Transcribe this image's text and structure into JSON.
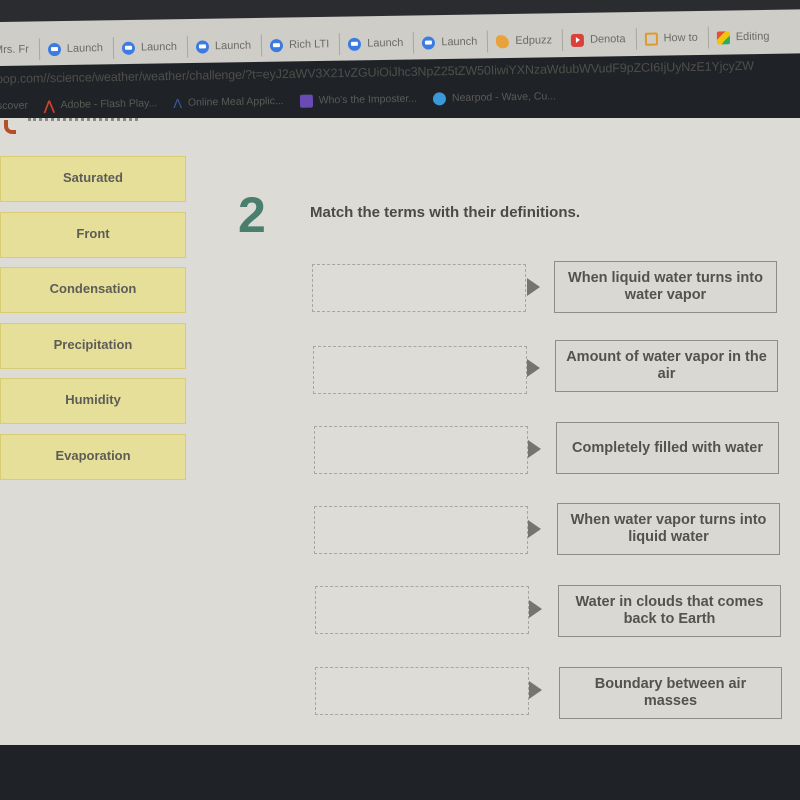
{
  "browser": {
    "tabs": [
      {
        "label": "Mrs. Fr",
        "icon": "none"
      },
      {
        "label": "Launch",
        "icon": "zoom-icon"
      },
      {
        "label": "Launch",
        "icon": "zoom-icon"
      },
      {
        "label": "Launch",
        "icon": "zoom-icon"
      },
      {
        "label": "Rich LTI",
        "icon": "zoom-icon"
      },
      {
        "label": "Launch",
        "icon": "zoom-icon"
      },
      {
        "label": "Launch",
        "icon": "zoom-icon"
      },
      {
        "label": "Edpuzz",
        "icon": "edpuzzle-icon"
      },
      {
        "label": "Denota",
        "icon": "youtube-icon"
      },
      {
        "label": "How to",
        "icon": "slides-icon"
      },
      {
        "label": "Editing",
        "icon": "editing-icon"
      }
    ],
    "url": "pop.com//science/weather/weather/challenge/?t=eyJ2aWV3X21vZGUiOiJhc3NpZ25tZW50IiwiYXNzaWdubWVudF9pZCI6IjUyNzE1YjcyZW",
    "bookmarks": [
      {
        "label": "scover",
        "icon": "none"
      },
      {
        "label": "Adobe - Flash Play...",
        "icon": "adobe-icon"
      },
      {
        "label": "Online Meal Applic...",
        "icon": "meal-app-icon"
      },
      {
        "label": "Who's the Imposter...",
        "icon": "forms-icon"
      },
      {
        "label": "Nearpod - Wave, Cu...",
        "icon": "nearpod-icon"
      }
    ]
  },
  "quiz": {
    "question_number": "2",
    "prompt": "Match the terms with their definitions.",
    "terms": [
      "Saturated",
      "Front",
      "Condensation",
      "Precipitation",
      "Humidity",
      "Evaporation"
    ],
    "definitions": [
      "When liquid water turns into water vapor",
      "Amount of water vapor in the air",
      "Completely filled with water",
      "When water vapor turns into liquid water",
      "Water in clouds that comes back to Earth",
      "Boundary between air masses"
    ],
    "colors": {
      "term_bg": "#e6df99",
      "question_number": "#4a7e6d"
    }
  }
}
